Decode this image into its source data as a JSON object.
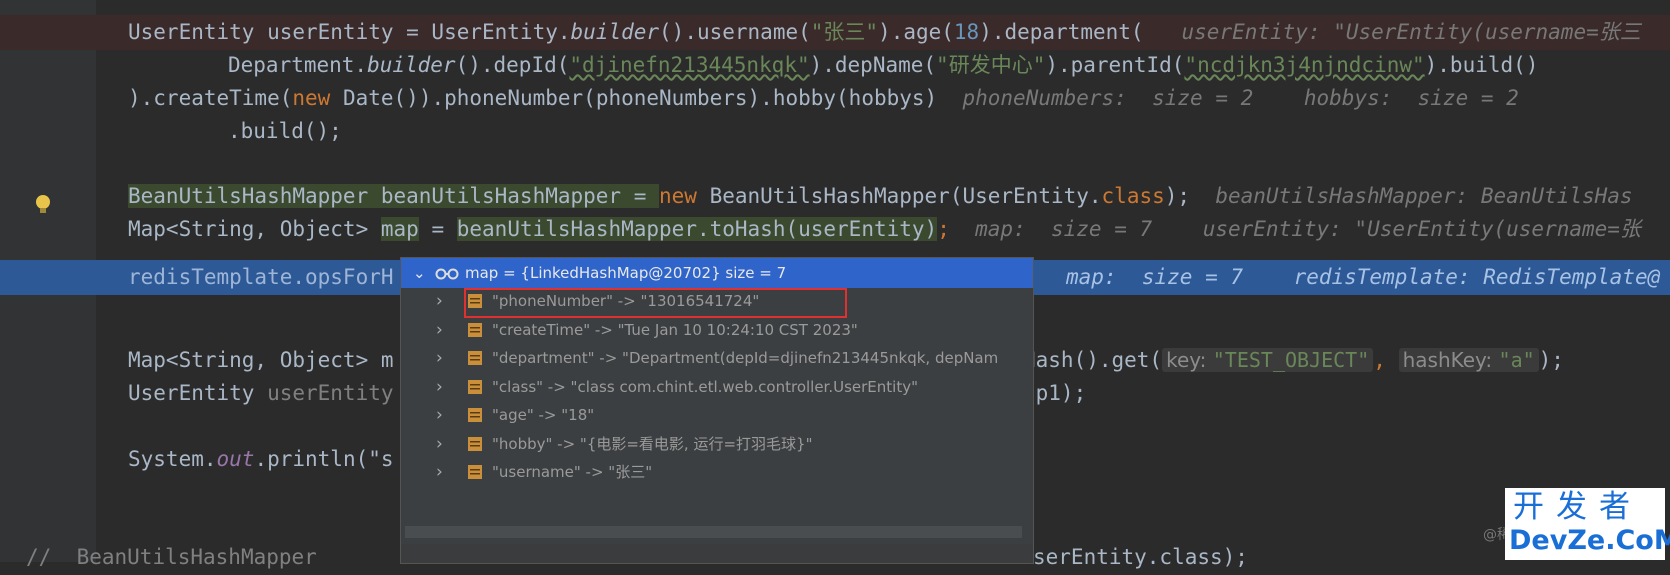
{
  "editor": {
    "line1": {
      "a": "UserEntity userEntity = UserEntity.",
      "b": "builder",
      "c": "().username(",
      "d": "\"张三\"",
      "e": ").age(",
      "f": "18",
      "g": ").department(",
      "hint": "userEntity: \"UserEntity(username=张三"
    },
    "line2": {
      "a": "Department.",
      "b": "builder",
      "c": "().depId(",
      "d": "\"djinefn213445nkqk\"",
      "e": ").depName(",
      "f": "\"研发中心\"",
      "g": ").parentId(",
      "h": "\"ncdjkn3j4njndcinw\"",
      "i": ").build()"
    },
    "line3": {
      "a": ").createTime(",
      "kw": "new",
      "b": " Date()).phoneNumber(phoneNumbers).hobby(hobbys)",
      "hint": "phoneNumbers:  size = 2    hobbys:  size = 2"
    },
    "line4": {
      "a": ".build();"
    },
    "line5": {
      "a": "BeanUtilsHashMapper beanUtilsHashMapper = ",
      "kw": "new",
      "b": " BeanUtilsHashMapper(UserEntity.",
      "kw2": "class",
      "c": ");",
      "hint": "beanUtilsHashMapper: BeanUtilsHas"
    },
    "line6": {
      "a": "Map<String, Object> ",
      "b": "map",
      "c": " = ",
      "d": "beanUtilsHashMapper.toHash(userEntity)",
      "e": ";",
      "hint": "map:  size = 7    userEntity: \"UserEntity(username=张"
    },
    "line7": {
      "a": "redisTemplate.opsForH",
      "hint": "map:  size = 7    redisTemplate: RedisTemplate@"
    },
    "line8": {
      "a": "Map<String, Object> m",
      "b": "Hash().get(",
      "p1": "key:",
      "v1": "\"TEST_OBJECT\"",
      "sep": ",",
      "p2": "hashKey:",
      "v2": "\"a\"",
      "e": ");"
    },
    "line9": {
      "a": "UserEntity ",
      "b": "userEntity",
      "c": "ap1);"
    },
    "line10": {
      "a": "System.",
      "b": "out",
      "c": ".println(\"s"
    },
    "line11": {
      "a": "//",
      "b": "BeanUtilsHashMapper",
      "c": "serEntity.class);"
    }
  },
  "popup": {
    "header": "map = {LinkedHashMap@20702}  size = 7",
    "items": [
      "\"phoneNumber\" -> \"13016541724\"",
      "\"createTime\" -> \"Tue Jan 10 10:24:10 CST 2023\"",
      "\"department\" -> \"Department(depId=djinefn213445nkqk, depNam",
      "\"class\" -> \"class com.chint.etl.web.controller.UserEntity\"",
      "\"age\" -> \"18\"",
      "\"hobby\" -> \"{电影=看电影, 运行=打羽毛球}\"",
      "\"username\" -> \"张三\""
    ]
  },
  "watermark": {
    "line1": "开发者",
    "line2": "DevZe.CoM",
    "at": "@稀"
  },
  "colors": {
    "keyword": "#cc7832",
    "string": "#6a8759",
    "number": "#6897bb",
    "exec_line": "#2d5a96",
    "popup_header": "#2f65ca",
    "highlight_box": "#e03030"
  },
  "icons": {
    "bulb": "lightbulb-icon",
    "expand": "chevron-right-icon",
    "field": "field-icon",
    "watch": "glasses-icon"
  }
}
